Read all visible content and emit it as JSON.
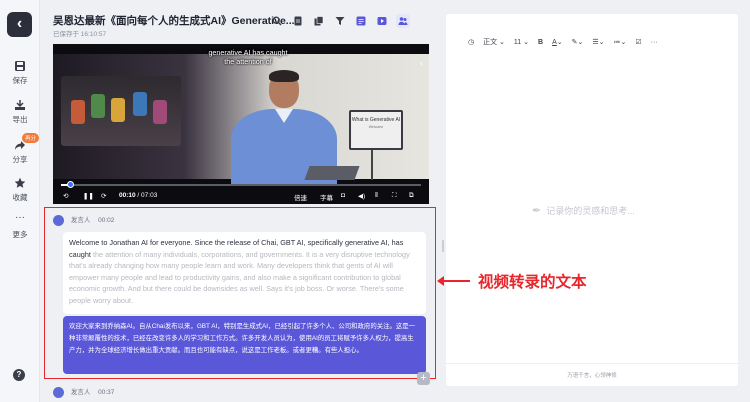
{
  "rail": {
    "save": "保存",
    "export": "导出",
    "share": "分享",
    "share_badge": "再分",
    "favorite": "收藏",
    "more": "更多"
  },
  "header": {
    "title": "吴恩达最新《面向每个人的生成式AI》Generative...",
    "subtitle": "已保存于 16:10:57"
  },
  "video": {
    "caption": "generative AI has caught the attention of",
    "screen_title": "What is Generative AI",
    "screen_sub": "Welcome",
    "time_current": "00:10",
    "time_total": "07:03",
    "progress_fraction": 0.024,
    "speed_label": "倍速",
    "subtitle_label": "字幕"
  },
  "transcript": {
    "speaker": "发言人",
    "time": "00:02",
    "en_spoken": "Welcome to Jonathan AI for everyone. Since the release of Chai, GBT AI, specifically generative AI, has caught",
    "en_rest": " the attention of many individuals, corporations, and governments. It is a very disruptive technology that's already changing how many people learn and work. Many developers think that gents of AI will empower many people and lead to productivity gains, and also make a significant contribution to global economic growth. And but there could be downsides as well. Says it's job boss. Or worse. There's some people worry about.",
    "cn": "欢迎大家来到乔纳森AI。自从Chai发布以来，GBT AI，特别是生成式AI，已经引起了许多个人、公司和政府的关注。这是一种非常颠覆性的技术，已经在改变许多人的学习和工作方式。许多开发人员认为，使用AI的员工将赋予许多人权力，提高生产力，并为全球经济增长做出重大贡献。而且也可能有缺点，说这是工作老板。或者更糟。有些人担心。",
    "next_speaker": "发言人",
    "next_time": "00:37"
  },
  "editor": {
    "style": "正文",
    "font_size": "11",
    "placeholder": "记录你的灵感和思考...",
    "footer": "万语千言，心领神修"
  },
  "annotation": {
    "text": "视频转录的文本"
  },
  "colors": {
    "accent": "#5b57d9",
    "annotation": "#e8262b",
    "badge": "#f07a3a"
  }
}
